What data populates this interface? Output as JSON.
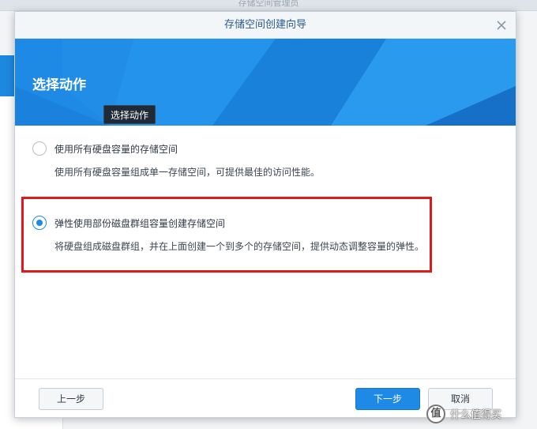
{
  "background": {
    "title": "存储空间管理员"
  },
  "dialog": {
    "title": "存储空间创建向导",
    "close_icon": "close-icon",
    "banner_heading": "选择动作",
    "tooltip": "选择动作"
  },
  "options": [
    {
      "label": "使用所有硬盘容量的存储空间",
      "description": "使用所有硬盘容量组成单一存储空间，可提供最佳的访问性能。",
      "selected": false
    },
    {
      "label": "弹性使用部份磁盘群组容量创建存储空间",
      "description": "将硬盘组成磁盘群组，并在上面创建一个到多个的存储空间，提供动态调整容量的弹性。",
      "selected": true
    }
  ],
  "footer": {
    "prev_label": "上一步",
    "next_label": "下一步",
    "cancel_label": "取消"
  },
  "watermark": {
    "icon_glyph": "值",
    "text": "什么值得买"
  },
  "colors": {
    "accent": "#1e8ae6",
    "highlight": "#e0191e"
  }
}
